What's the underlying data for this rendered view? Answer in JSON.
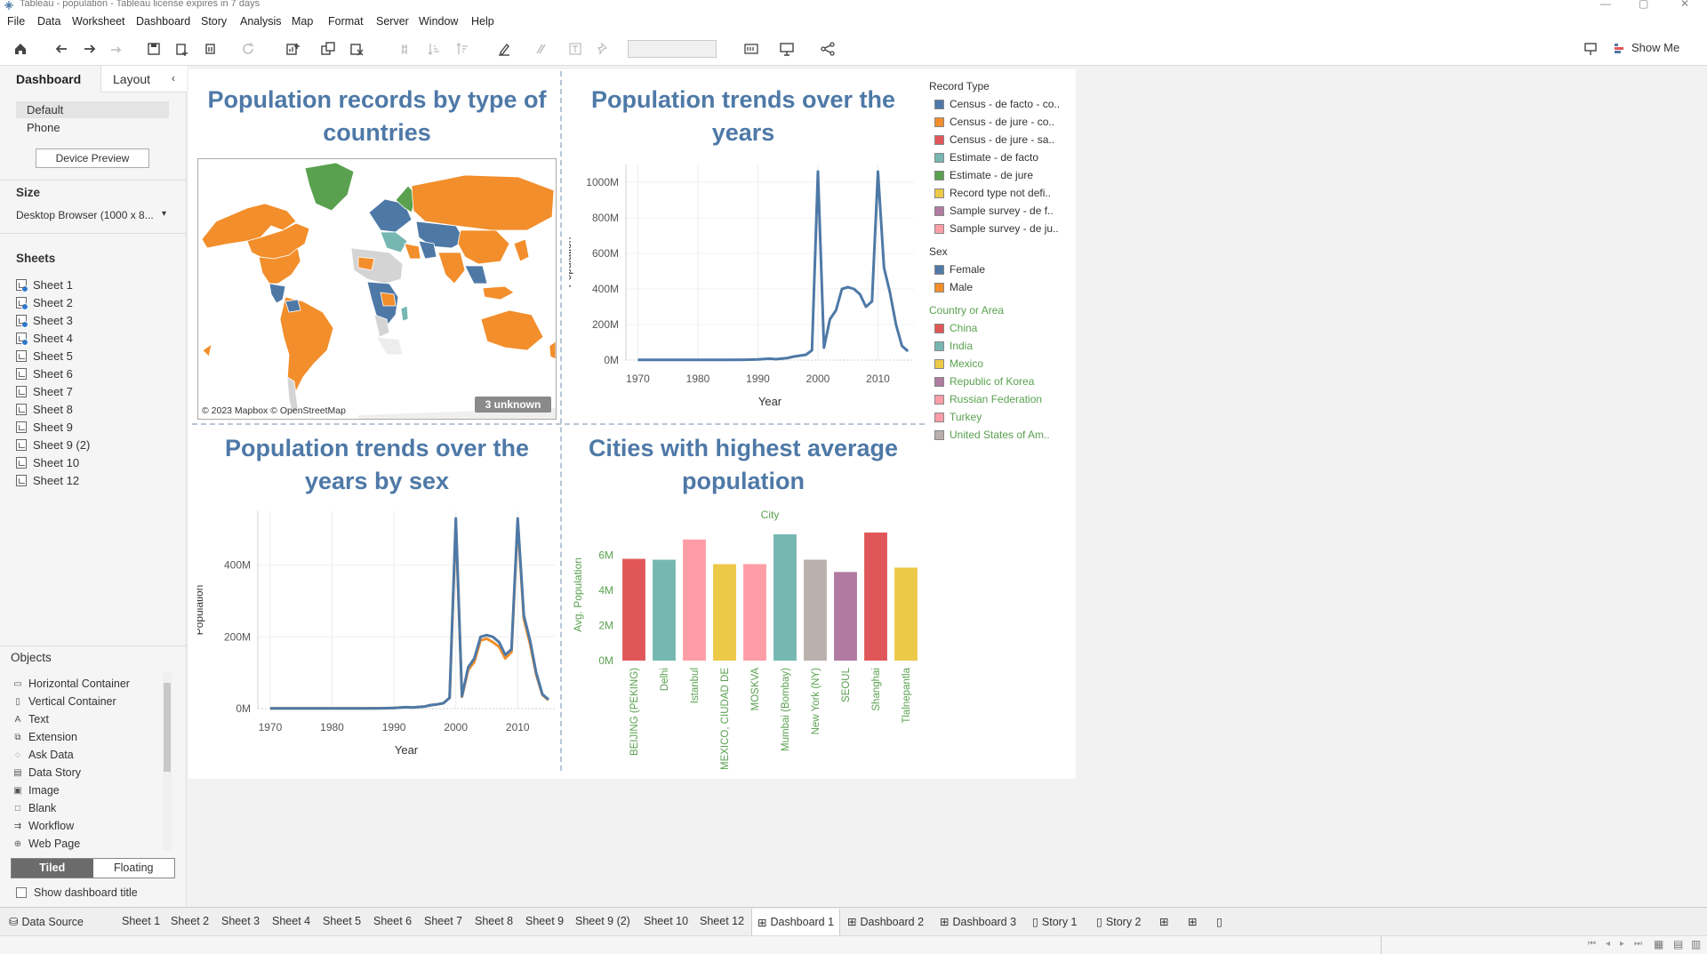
{
  "window": {
    "title": "Tableau - population - Tableau license expires in 7 days"
  },
  "menu": [
    "File",
    "Data",
    "Worksheet",
    "Dashboard",
    "Story",
    "Analysis",
    "Map",
    "Format",
    "Server",
    "Window",
    "Help"
  ],
  "toolbar": {
    "show_me_label": "Show Me"
  },
  "left_pane": {
    "tab_dashboard": "Dashboard",
    "tab_layout": "Layout",
    "devices": [
      "Default",
      "Phone"
    ],
    "device_preview_label": "Device Preview",
    "size_title": "Size",
    "size_value": "Desktop Browser (1000 x 8...",
    "sheets_title": "Sheets",
    "sheets": [
      "Sheet 1",
      "Sheet 2",
      "Sheet 3",
      "Sheet 4",
      "Sheet 5",
      "Sheet 6",
      "Sheet 7",
      "Sheet 8",
      "Sheet 9",
      "Sheet 9 (2)",
      "Sheet 10",
      "Sheet 12"
    ],
    "objects_title": "Objects",
    "objects": [
      "Horizontal Container",
      "Vertical Container",
      "Text",
      "Extension",
      "Ask Data",
      "Data Story",
      "Image",
      "Blank",
      "Workflow",
      "Web Page"
    ],
    "tiled_label": "Tiled",
    "floating_label": "Floating",
    "show_title_label": "Show dashboard title"
  },
  "dashboard": {
    "map_title": "Population records by type of countries",
    "map_attribution": "© 2023 Mapbox © OpenStreetMap",
    "map_unknown_badge": "3 unknown",
    "trend_title": "Population trends over the years",
    "sex_title": "Population trends over the years by sex",
    "cities_title": "Cities with highest average population"
  },
  "legends": {
    "record_type": {
      "title": "Record Type",
      "items": [
        {
          "label": "Census - de facto - co..",
          "color": "#4e79a7"
        },
        {
          "label": "Census - de jure - co..",
          "color": "#f28e2b"
        },
        {
          "label": "Census - de jure - sa..",
          "color": "#e15759"
        },
        {
          "label": "Estimate - de facto",
          "color": "#76b7b2"
        },
        {
          "label": "Estimate - de jure",
          "color": "#59a14f"
        },
        {
          "label": "Record type not defi..",
          "color": "#edc948"
        },
        {
          "label": "Sample survey - de f..",
          "color": "#b07aa1"
        },
        {
          "label": "Sample survey - de ju..",
          "color": "#ff9da7"
        }
      ]
    },
    "sex": {
      "title": "Sex",
      "items": [
        {
          "label": "Female",
          "color": "#4e79a7"
        },
        {
          "label": "Male",
          "color": "#f28e2b"
        }
      ]
    },
    "country": {
      "title": "Country or Area",
      "items": [
        {
          "label": "China",
          "color": "#e15759"
        },
        {
          "label": "India",
          "color": "#76b7b2"
        },
        {
          "label": "Mexico",
          "color": "#edc948"
        },
        {
          "label": "Republic of Korea",
          "color": "#b07aa1"
        },
        {
          "label": "Russian Federation",
          "color": "#ff9da7"
        },
        {
          "label": "Turkey",
          "color": "#ff9da7"
        },
        {
          "label": "United States of Am..",
          "color": "#bab0ac"
        }
      ]
    }
  },
  "chart_data": [
    {
      "type": "line",
      "title": "Population trends over the years",
      "xlabel": "Year",
      "ylabel": "Population",
      "x_ticks": [
        "1970",
        "1980",
        "1990",
        "2000",
        "2010"
      ],
      "y_ticks": [
        "0M",
        "200M",
        "400M",
        "600M",
        "800M",
        "1000M"
      ],
      "xlim": [
        1968,
        2016
      ],
      "ylim": [
        0,
        1100
      ],
      "series": [
        {
          "color": "#4e79a7",
          "x": [
            1970,
            1975,
            1980,
            1985,
            1988,
            1990,
            1992,
            1993,
            1995,
            1996,
            1997,
            1998,
            1999,
            2000,
            2001,
            2002,
            2003,
            2004,
            2005,
            2006,
            2007,
            2008,
            2009,
            2010,
            2011,
            2012,
            2013,
            2014,
            2015
          ],
          "values": [
            1,
            1,
            1,
            1,
            2,
            4,
            8,
            5,
            12,
            20,
            25,
            30,
            55,
            1060,
            70,
            230,
            280,
            400,
            410,
            400,
            370,
            300,
            330,
            1060,
            520,
            380,
            200,
            80,
            50
          ]
        }
      ],
      "grid": true
    },
    {
      "type": "line",
      "title": "Population trends over the years by sex",
      "xlabel": "Year",
      "ylabel": "Population",
      "x_ticks": [
        "1970",
        "1980",
        "1990",
        "2000",
        "2010"
      ],
      "y_ticks": [
        "0M",
        "200M",
        "400M"
      ],
      "xlim": [
        1968,
        2016
      ],
      "ylim": [
        0,
        550
      ],
      "series": [
        {
          "name": "Female",
          "color": "#4e79a7",
          "x": [
            1970,
            1975,
            1980,
            1985,
            1988,
            1990,
            1992,
            1993,
            1995,
            1996,
            1997,
            1998,
            1999,
            2000,
            2001,
            2002,
            2003,
            2004,
            2005,
            2006,
            2007,
            2008,
            2009,
            2010,
            2011,
            2012,
            2013,
            2014,
            2015
          ],
          "values": [
            0.5,
            0.5,
            0.5,
            0.5,
            1,
            2,
            4,
            3,
            6,
            10,
            12,
            15,
            30,
            530,
            35,
            115,
            140,
            200,
            205,
            200,
            185,
            150,
            165,
            530,
            260,
            190,
            100,
            40,
            25
          ]
        },
        {
          "name": "Male",
          "color": "#f28e2b",
          "x": [
            1970,
            1975,
            1980,
            1985,
            1988,
            1990,
            1992,
            1993,
            1995,
            1996,
            1997,
            1998,
            1999,
            2000,
            2001,
            2002,
            2003,
            2004,
            2005,
            2006,
            2007,
            2008,
            2009,
            2010,
            2011,
            2012,
            2013,
            2014,
            2015
          ],
          "values": [
            0.5,
            0.5,
            0.5,
            0.5,
            1,
            2,
            4,
            3,
            6,
            10,
            12,
            15,
            30,
            520,
            33,
            108,
            130,
            190,
            195,
            185,
            172,
            140,
            158,
            520,
            250,
            180,
            95,
            38,
            24
          ]
        }
      ],
      "grid": true
    },
    {
      "type": "bar",
      "title": "Cities with highest average population",
      "x_header": "City",
      "ylabel": "Avg. Population",
      "y_ticks": [
        "0M",
        "2M",
        "4M",
        "6M"
      ],
      "ylim": [
        0,
        7.5
      ],
      "categories": [
        "BEIJING (PEKING)",
        "Delhi",
        "Istanbul",
        "MEXICO, CIUDAD DE",
        "MOSKVA",
        "Mumbai (Bombay)",
        "New York (NY)",
        "SEOUL",
        "Shanghai",
        "Tlalnepantla"
      ],
      "values": [
        5.8,
        5.75,
        6.9,
        5.5,
        5.5,
        7.2,
        5.75,
        5.05,
        7.3,
        5.3
      ],
      "colors": [
        "#e15759",
        "#76b7b2",
        "#ff9da7",
        "#edc948",
        "#ff9da7",
        "#76b7b2",
        "#bab0ac",
        "#b07aa1",
        "#e15759",
        "#edc948"
      ],
      "grid": false
    }
  ],
  "bottom_tabs": [
    "Data Source",
    "Sheet 1",
    "Sheet 2",
    "Sheet 3",
    "Sheet 4",
    "Sheet 5",
    "Sheet 6",
    "Sheet 7",
    "Sheet 8",
    "Sheet 9",
    "Sheet 9 (2)",
    "Sheet 10",
    "Sheet 12",
    "Dashboard 1",
    "Dashboard 2",
    "Dashboard 3",
    "Story 1",
    "Story 2"
  ],
  "active_tab": "Dashboard 1"
}
